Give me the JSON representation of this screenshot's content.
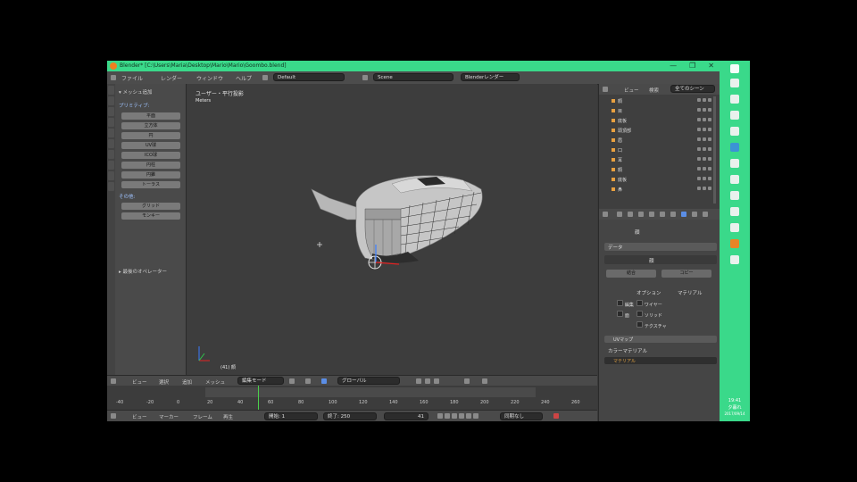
{
  "window": {
    "title": "Blender* [C:\\Users\\Maria\\Desktop\\Mario\\Mario\\Goombo.blend]",
    "controls": [
      "—",
      "❐",
      "✕"
    ]
  },
  "menubar": {
    "items": [
      "ファイル",
      "レンダー",
      "ウィンドウ",
      "ヘルプ"
    ],
    "layout_field": "Default",
    "scene_field": "Scene",
    "engine_field": "Blenderレンダー"
  },
  "toolshelf": {
    "section_add": "▾ メッシュ追加",
    "primitive_label": "プリミティブ:",
    "add_buttons": [
      "平面",
      "立方体",
      "円",
      "UV球",
      "ICO球",
      "円柱",
      "円錐",
      "トーラス"
    ],
    "other_label": "その他:",
    "other_buttons": [
      "グリッド",
      "モンキー"
    ],
    "last_op": "▸ 最後のオペレーター"
  },
  "viewport": {
    "view_label": "ユーザー・平行投影",
    "unit_label": "Meters",
    "object_label": "(41) 顔"
  },
  "viewport_header": {
    "items": [
      "ビュー",
      "選択",
      "追加",
      "メッシュ"
    ],
    "mode": "編集モード",
    "pivot": "グローバル"
  },
  "timeline": {
    "ticks": [
      "-40",
      "-20",
      "0",
      "20",
      "40",
      "60",
      "80",
      "100",
      "120",
      "140",
      "160",
      "180",
      "200",
      "220",
      "240",
      "260"
    ],
    "header_items": [
      "ビュー",
      "マーカー",
      "フレーム",
      "再生"
    ],
    "start_label": "開始:",
    "start_value": "1",
    "end_label": "終了:",
    "end_value": "250",
    "current_frame": "41",
    "sync": "同期なし"
  },
  "outliner": {
    "header_items": [
      "ビュー",
      "検索",
      "全てのシーン"
    ],
    "rows": [
      "顔",
      "目",
      "底板",
      "頭頂部",
      "眉",
      "口",
      "耳",
      "顔",
      "底板",
      "鼻"
    ]
  },
  "properties": {
    "object_name": "顔",
    "data_name": "顔",
    "buttons": [
      "結合",
      "コピー"
    ],
    "layer_header": "データ",
    "col_labels": [
      "オプション",
      "マテリアル"
    ],
    "checks": [
      "編集",
      "ワイヤー",
      "面",
      "ソリッド",
      "テクスチャ"
    ],
    "modifier_label": "UVマップ",
    "material_label": "カラーマテリアル",
    "material_value": "マテリアル"
  },
  "taskbar": {
    "time": "19:41",
    "date": "2017/09/14",
    "label": "夕暮れ"
  }
}
